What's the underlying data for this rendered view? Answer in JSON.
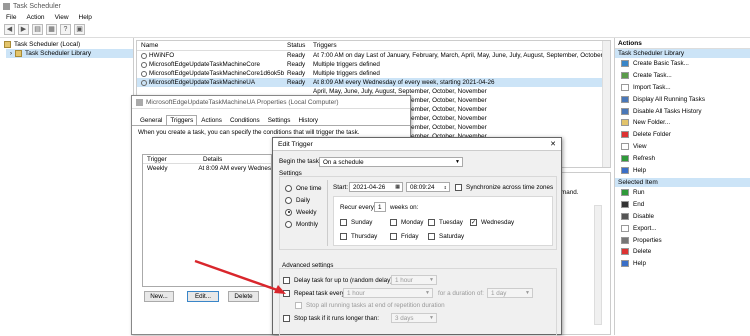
{
  "window": {
    "title": "Task Scheduler"
  },
  "menu": [
    "File",
    "Action",
    "View",
    "Help"
  ],
  "tree": {
    "root": "Task Scheduler (Local)",
    "library": "Task Scheduler Library"
  },
  "tasklist": {
    "columns": [
      "Name",
      "Status",
      "Triggers"
    ],
    "rows": [
      {
        "name": "HWiNFO",
        "status": "Ready",
        "trigger": "At 7:00 AM on day Last of January, February, March, April, May, June, July, August, September, October, November"
      },
      {
        "name": "MicrosoftEdgeUpdateTaskMachineCore",
        "status": "Ready",
        "trigger": "Multiple triggers defined"
      },
      {
        "name": "MicrosoftEdgeUpdateTaskMachineCore1d6ok5b2f...",
        "status": "Ready",
        "trigger": "Multiple triggers defined"
      },
      {
        "name": "MicrosoftEdgeUpdateTaskMachineUA",
        "status": "Ready",
        "trigger": "At 8:09 AM every Wednesday of every week, starting 2021-04-26"
      },
      {
        "name": "",
        "status": "",
        "trigger": "April, May, June, July, August, September, October, November"
      },
      {
        "name": "",
        "status": "",
        "trigger": "April, May, June, July, August, September, October, November"
      },
      {
        "name": "",
        "status": "",
        "trigger": "April, May, June, July, August, September, October, November"
      },
      {
        "name": "",
        "status": "",
        "trigger": "April, May, June, July, August, September, October, November"
      },
      {
        "name": "",
        "status": "",
        "trigger": "April, May, June, July, August, September, October, November"
      },
      {
        "name": "",
        "status": "",
        "trigger": "April, May, June, July, August, September, October, November"
      },
      {
        "name": "",
        "status": "",
        "trigger": "April, May, June, July, August, September, October, November"
      }
    ]
  },
  "properties": {
    "title": "MicrosoftEdgeUpdateTaskMachineUA Properties (Local Computer)",
    "tabs": [
      "General",
      "Triggers",
      "Actions",
      "Conditions",
      "Settings",
      "History"
    ],
    "description": "When you create a task, you can specify the conditions that will trigger the task.",
    "table_columns": [
      "Trigger",
      "Details"
    ],
    "table_row": {
      "trigger": "Weekly",
      "details": "At 8:09 AM every Wednes"
    },
    "buttons": {
      "new": "New...",
      "edit": "Edit...",
      "delete": "Delete"
    },
    "behind_text": "mand."
  },
  "edit_trigger": {
    "title": "Edit Trigger",
    "close": "✕",
    "begin_label": "Begin the task:",
    "begin_value": "On a schedule",
    "settings_label": "Settings",
    "radios": [
      "One time",
      "Daily",
      "Weekly",
      "Monthly"
    ],
    "selected_radio": "Weekly",
    "start_label": "Start:",
    "start_date": "2021-04-26",
    "start_time": "08:09:24",
    "sync_label": "Synchronize across time zones",
    "recur_label": "Recur every:",
    "recur_value": "1",
    "weeks_on": "weeks on:",
    "days": [
      "Sunday",
      "Monday",
      "Tuesday",
      "Wednesday",
      "Thursday",
      "Friday",
      "Saturday"
    ],
    "checked_day": "Wednesday",
    "advanced_label": "Advanced settings",
    "delay_label": "Delay task for up to (random delay):",
    "delay_value": "1 hour",
    "repeat_label": "Repeat task every:",
    "repeat_value": "1 hour",
    "duration_label": "for a duration of:",
    "duration_value": "1 day",
    "stop_running_label": "Stop all running tasks at end of repetition duration",
    "stop_longer_label": "Stop task if it runs longer than:",
    "stop_longer_value": "3 days"
  },
  "actions": {
    "header": "Actions",
    "group1": "Task Scheduler Library",
    "items1": [
      {
        "label": "Create Basic Task...",
        "icon": "create-basic-task-icon",
        "color": "#3a86c8"
      },
      {
        "label": "Create Task...",
        "icon": "create-task-icon",
        "color": "#5a9b4a"
      },
      {
        "label": "Import Task...",
        "icon": "import-icon",
        "color": "#ffffff"
      },
      {
        "label": "Display All Running Tasks",
        "icon": "running-tasks-icon",
        "color": "#4a78b8"
      },
      {
        "label": "Disable All Tasks History",
        "icon": "history-icon",
        "color": "#4a78b8"
      },
      {
        "label": "New Folder...",
        "icon": "folder-icon",
        "color": "#e3c46b"
      },
      {
        "label": "Delete Folder",
        "icon": "delete-folder-icon",
        "color": "#d33"
      },
      {
        "label": "View",
        "icon": "view-icon",
        "color": "#ffffff"
      },
      {
        "label": "Refresh",
        "icon": "refresh-icon",
        "color": "#2f9a3a"
      },
      {
        "label": "Help",
        "icon": "help-icon",
        "color": "#3a6fc8"
      }
    ],
    "group2": "Selected Item",
    "items2": [
      {
        "label": "Run",
        "icon": "run-icon",
        "color": "#2f9a3a"
      },
      {
        "label": "End",
        "icon": "end-icon",
        "color": "#333333"
      },
      {
        "label": "Disable",
        "icon": "disable-icon",
        "color": "#555555"
      },
      {
        "label": "Export...",
        "icon": "export-icon",
        "color": "#ffffff"
      },
      {
        "label": "Properties",
        "icon": "properties-icon",
        "color": "#777777"
      },
      {
        "label": "Delete",
        "icon": "delete-icon",
        "color": "#d33"
      },
      {
        "label": "Help",
        "icon": "help-icon",
        "color": "#3a6fc8"
      }
    ]
  },
  "annotation": {
    "arrow_color": "#d9262c"
  }
}
